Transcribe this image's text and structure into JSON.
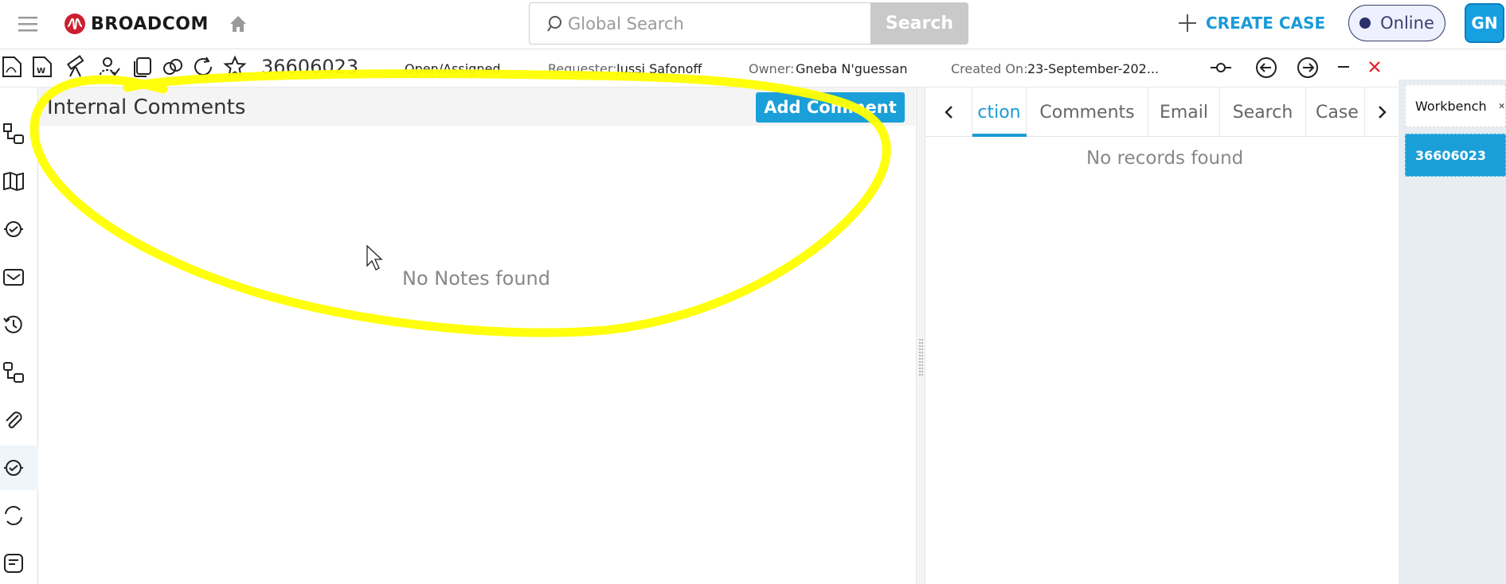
{
  "topbar": {
    "brand": "BROADCOM",
    "search_placeholder": "Global Search",
    "search_button": "Search",
    "create_case": "CREATE CASE",
    "status": "Online",
    "avatar_initials": "GN"
  },
  "case": {
    "number": "36606023",
    "status": "Open/Assigned",
    "requester_label": "Requester:",
    "requester": "Jussi Safonoff",
    "owner_label": "Owner:",
    "owner": "Gneba N'guessan",
    "created_label": "Created On:",
    "created": "23-September-202..."
  },
  "comments": {
    "title": "Internal Comments",
    "add_button": "Add Comment",
    "empty": "No Notes found"
  },
  "right_panel": {
    "tabs": [
      "ction",
      "Comments",
      "Email",
      "Search",
      "Case"
    ],
    "empty": "No records found"
  },
  "workbench": {
    "tab_label": "Workbench",
    "case_tab": "36606023"
  },
  "colors": {
    "accent": "#1a9fd9",
    "annotation": "#ffff00",
    "close": "#e0202a"
  }
}
